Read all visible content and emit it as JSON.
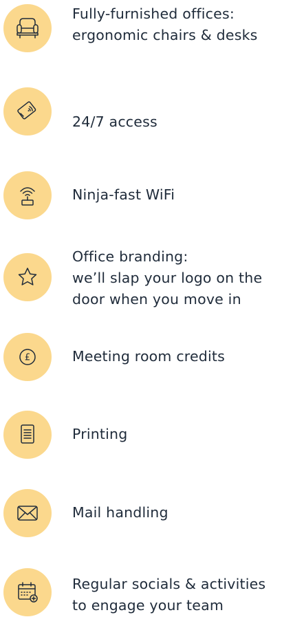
{
  "features": [
    {
      "icon": "armchair-icon",
      "lines": [
        "Fully-furnished offices:",
        "ergonomic chairs & desks"
      ]
    },
    {
      "icon": "access-card-icon",
      "lines": [
        "24/7 access"
      ]
    },
    {
      "icon": "wifi-router-icon",
      "lines": [
        "Ninja-fast WiFi"
      ]
    },
    {
      "icon": "star-icon",
      "lines": [
        "Office branding:",
        "we’ll slap your logo on the",
        "door when you move in"
      ]
    },
    {
      "icon": "pound-coin-icon",
      "lines": [
        "Meeting room credits"
      ],
      "icon_glyph": "£"
    },
    {
      "icon": "document-icon",
      "lines": [
        "Printing"
      ]
    },
    {
      "icon": "envelope-icon",
      "lines": [
        "Mail handling"
      ]
    },
    {
      "icon": "calendar-add-icon",
      "lines": [
        "Regular socials & activities",
        "to engage your team"
      ]
    }
  ],
  "colors": {
    "icon_circle": "#fbd88d",
    "text": "#1f2b3a",
    "background": "#ffffff"
  }
}
